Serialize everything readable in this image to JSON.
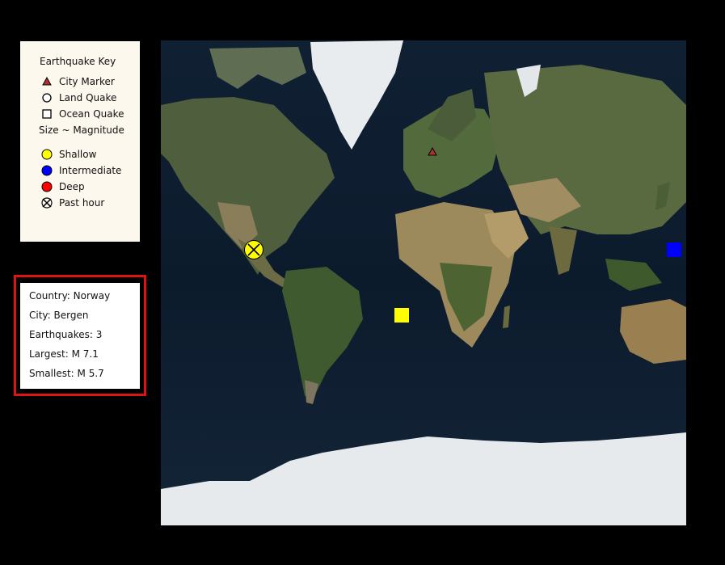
{
  "key": {
    "title": "Earthquake Key",
    "city_marker": "City Marker",
    "land_quake": "Land Quake",
    "ocean_quake": "Ocean Quake",
    "size_note": "Size ~ Magnitude",
    "shallow": "Shallow",
    "intermediate": "Intermediate",
    "deep": "Deep",
    "past_hour": "Past hour"
  },
  "info": {
    "country": "Country: Norway",
    "city": "City: Bergen",
    "earthquakes": "Earthquakes: 3",
    "largest": "Largest: M 7.1",
    "smallest": "Smallest: M 5.7"
  },
  "colors": {
    "shallow": "#ffff00",
    "intermediate": "#0000ff",
    "deep": "#ff0000",
    "city_marker": "#b03030",
    "selection_border": "#e01212"
  },
  "map": {
    "type": "satellite world map",
    "projection": "mercator"
  }
}
